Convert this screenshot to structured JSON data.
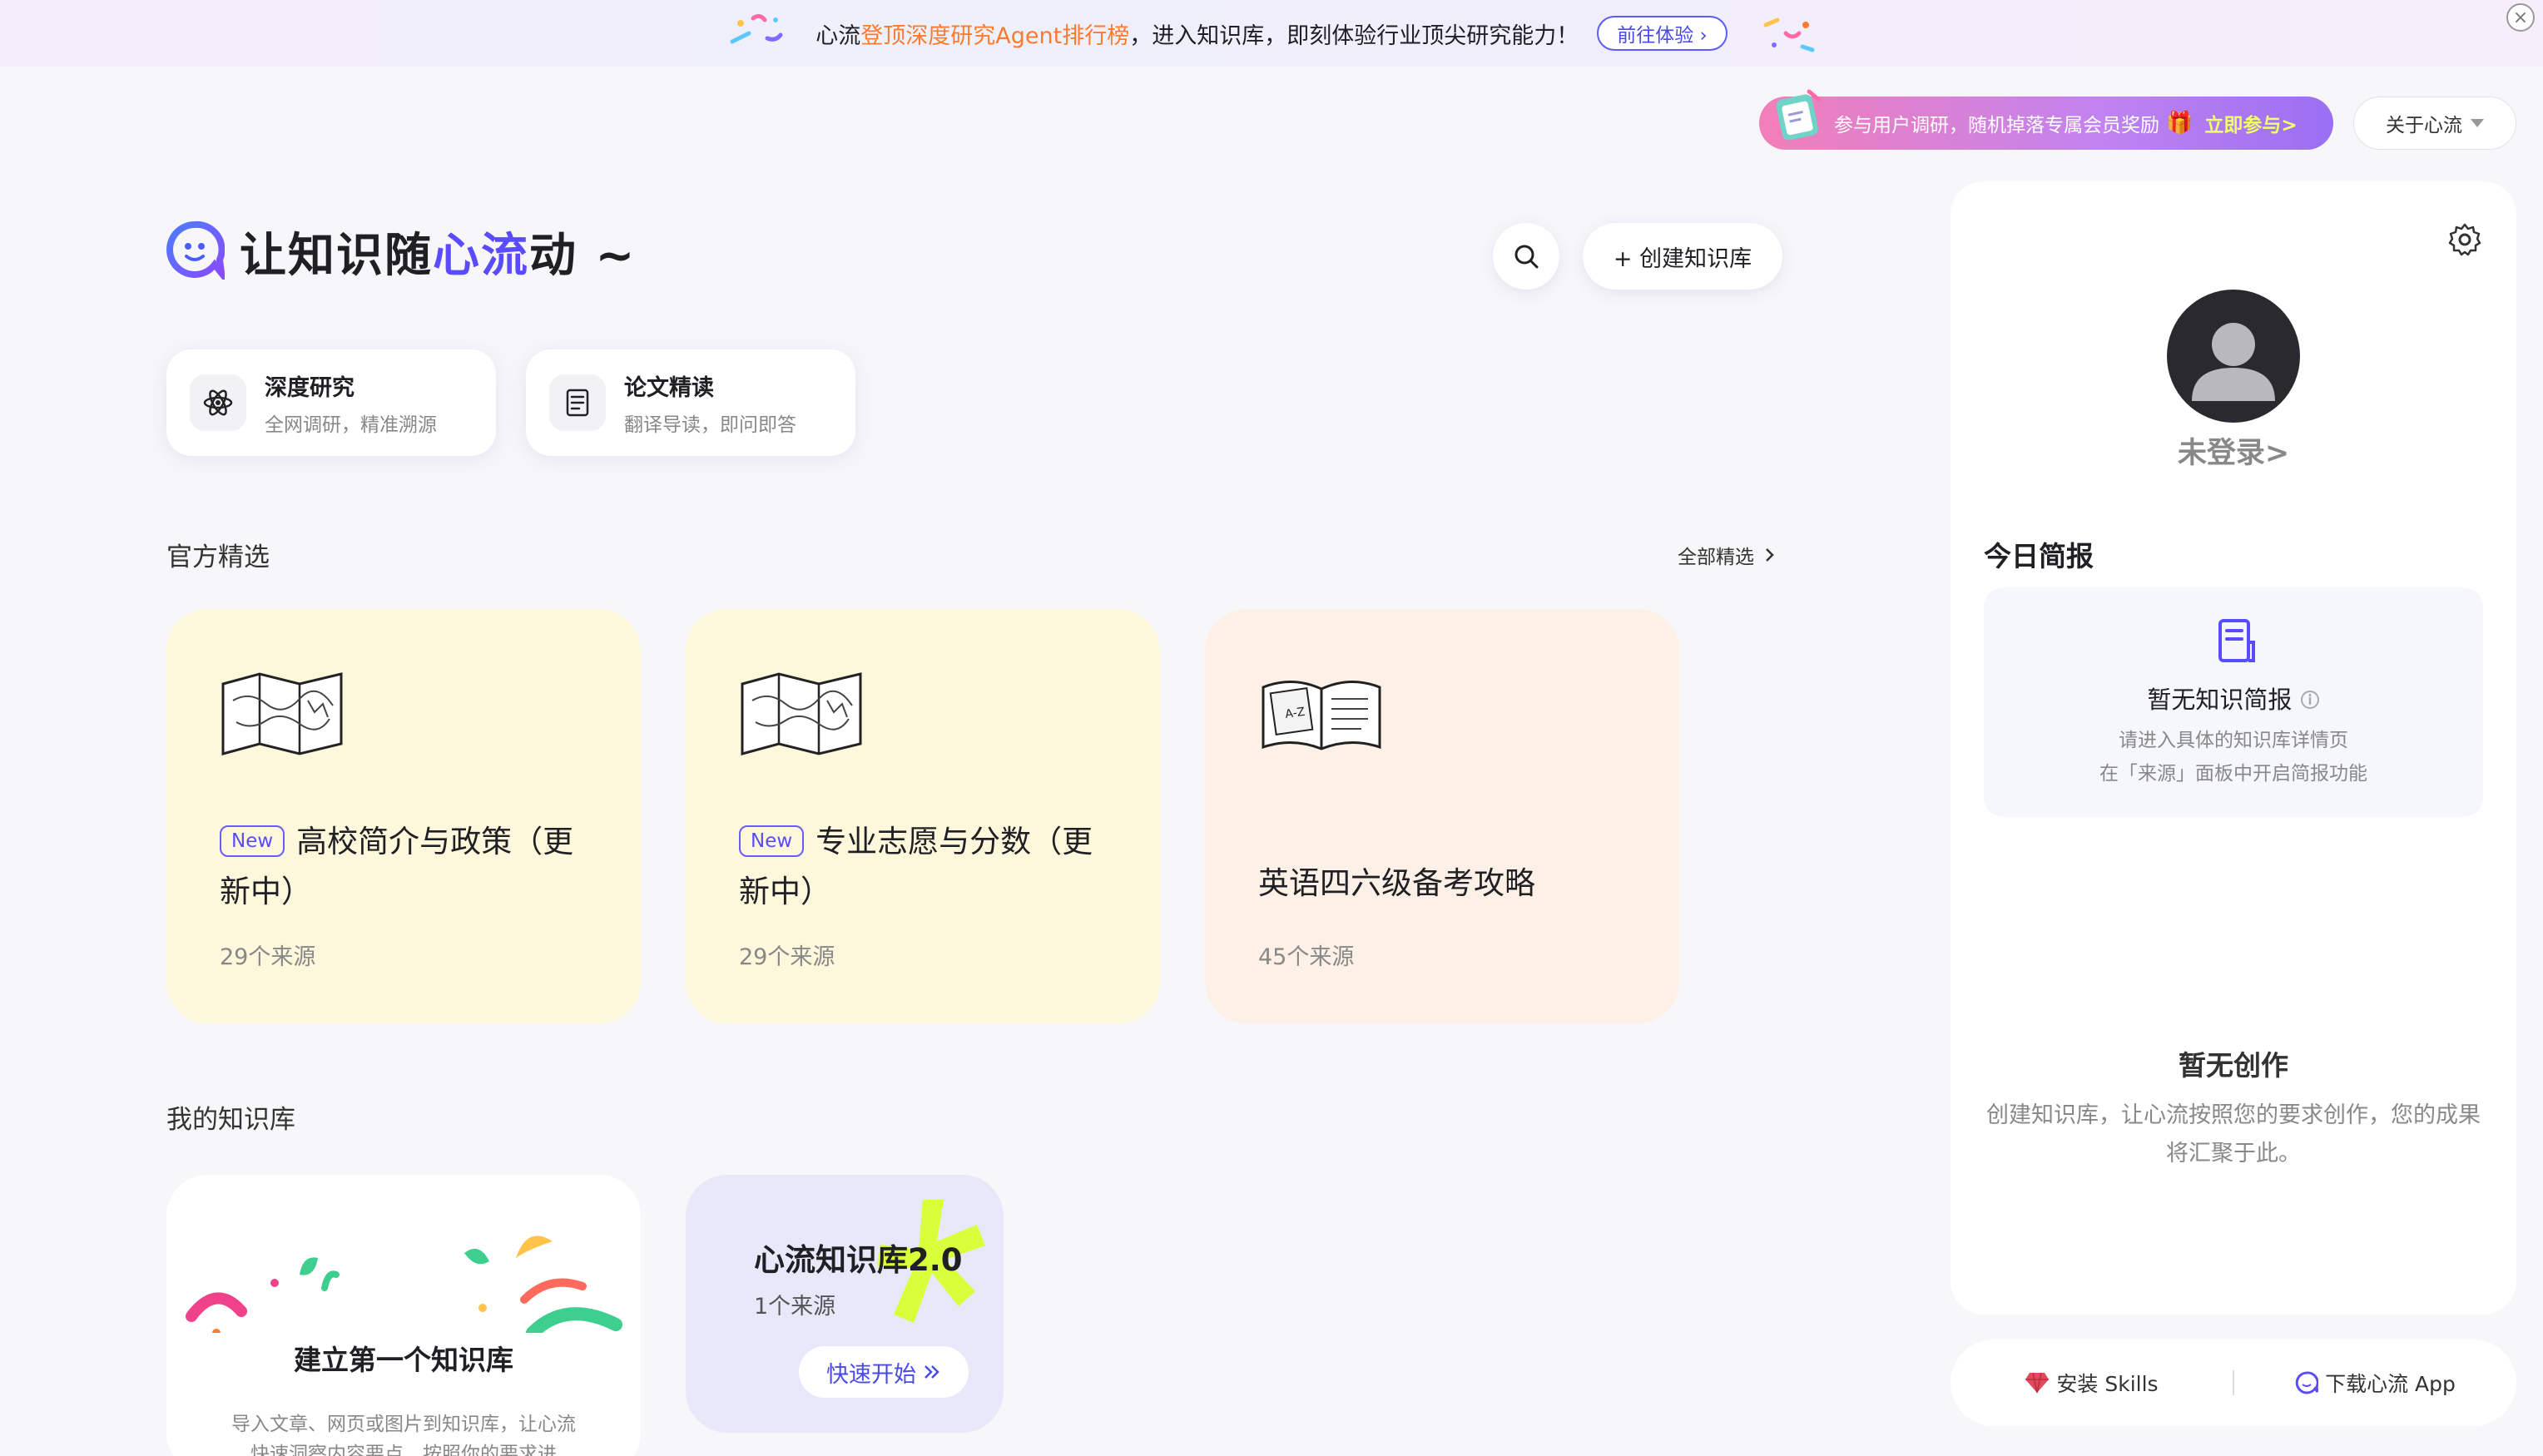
{
  "banner": {
    "text_a": "心流",
    "text_b": "登顶深度研究Agent排行榜",
    "text_c": "，进入知识库，即刻体验行业顶尖研究能力！",
    "button": "前往体验 ›",
    "close": "×"
  },
  "survey": {
    "text": "参与用户调研，随机掉落专属会员奖励",
    "join": "立即参与>"
  },
  "about": {
    "label": "关于心流"
  },
  "headline": {
    "part1": "让知识随",
    "accent": "心流",
    "part2": "动 ~"
  },
  "toolbar": {
    "create_label": "+ 创建知识库"
  },
  "tools": [
    {
      "title": "深度研究",
      "subtitle": "全网调研，精准溯源"
    },
    {
      "title": "论文精读",
      "subtitle": "翻译导读，即问即答"
    }
  ],
  "featured": {
    "section_title": "官方精选",
    "more_label": "全部精选",
    "cards": [
      {
        "badge": "New",
        "title": "高校简介与政策（更新中）",
        "count": "29个来源",
        "color": "#fdf8dc"
      },
      {
        "badge": "New",
        "title": "专业志愿与分数（更新中）",
        "count": "29个来源",
        "color": "#fdf8dc"
      },
      {
        "badge": "",
        "title": "英语四六级备考攻略",
        "count": "45个来源",
        "color": "#fdf0e6"
      }
    ]
  },
  "mykb": {
    "section_title": "我的知识库",
    "create_first": {
      "title": "建立第一个知识库",
      "desc": "导入文章、网页或图片到知识库，让心流快速洞察内容要点，按照你的要求进"
    },
    "kb": {
      "title": "心流知识库2.0",
      "count": "1个来源",
      "start": "快速开始"
    }
  },
  "panel": {
    "login": "未登录>",
    "today_title": "今日简报",
    "brief_title": "暂无知识简报",
    "brief_line1": "请进入具体的知识库详情页",
    "brief_line2": "在「来源」面板中开启简报功能",
    "nocreate_title": "暂无创作",
    "nocreate_desc": "创建知识库，让心流按照您的要求创作，您的成果将汇聚于此。",
    "install_skills": "安装 Skills",
    "download_app": "下载心流 App"
  }
}
